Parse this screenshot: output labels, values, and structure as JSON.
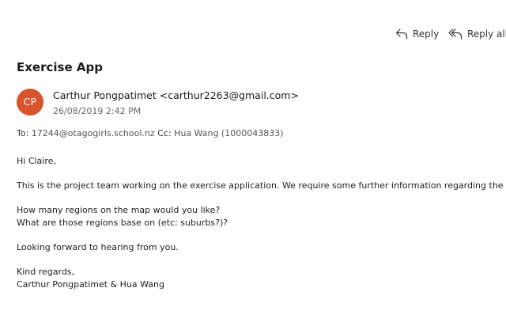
{
  "toolbar": {
    "reply_label": "Reply",
    "reply_all_label": "Reply all"
  },
  "email": {
    "subject": "Exercise App",
    "avatar_initials": "CP",
    "avatar_color": "#d9532c",
    "sender_name": "Carthur Pongpatimet",
    "sender_email": "<carthur2263@gmail.com>",
    "datetime": "26/08/2019 2:42 PM",
    "to_label": "To:",
    "to_value": "17244@otagogirls.school.nz",
    "cc_label": "Cc:",
    "cc_value": "Hua Wang (1000043833)",
    "body": {
      "greeting": "Hi Claire,",
      "para1": "This is the project team working on the exercise application. We require some further information regarding the clustering of p",
      "question1": "How many regions on the map would you like?",
      "question2": "What are those regions base on (etc: suburbs?)?",
      "closing_line": "Looking forward to hearing from you.",
      "signoff": "Kind regards,",
      "signature": "Carthur Pongpatimet & Hua Wang"
    }
  }
}
